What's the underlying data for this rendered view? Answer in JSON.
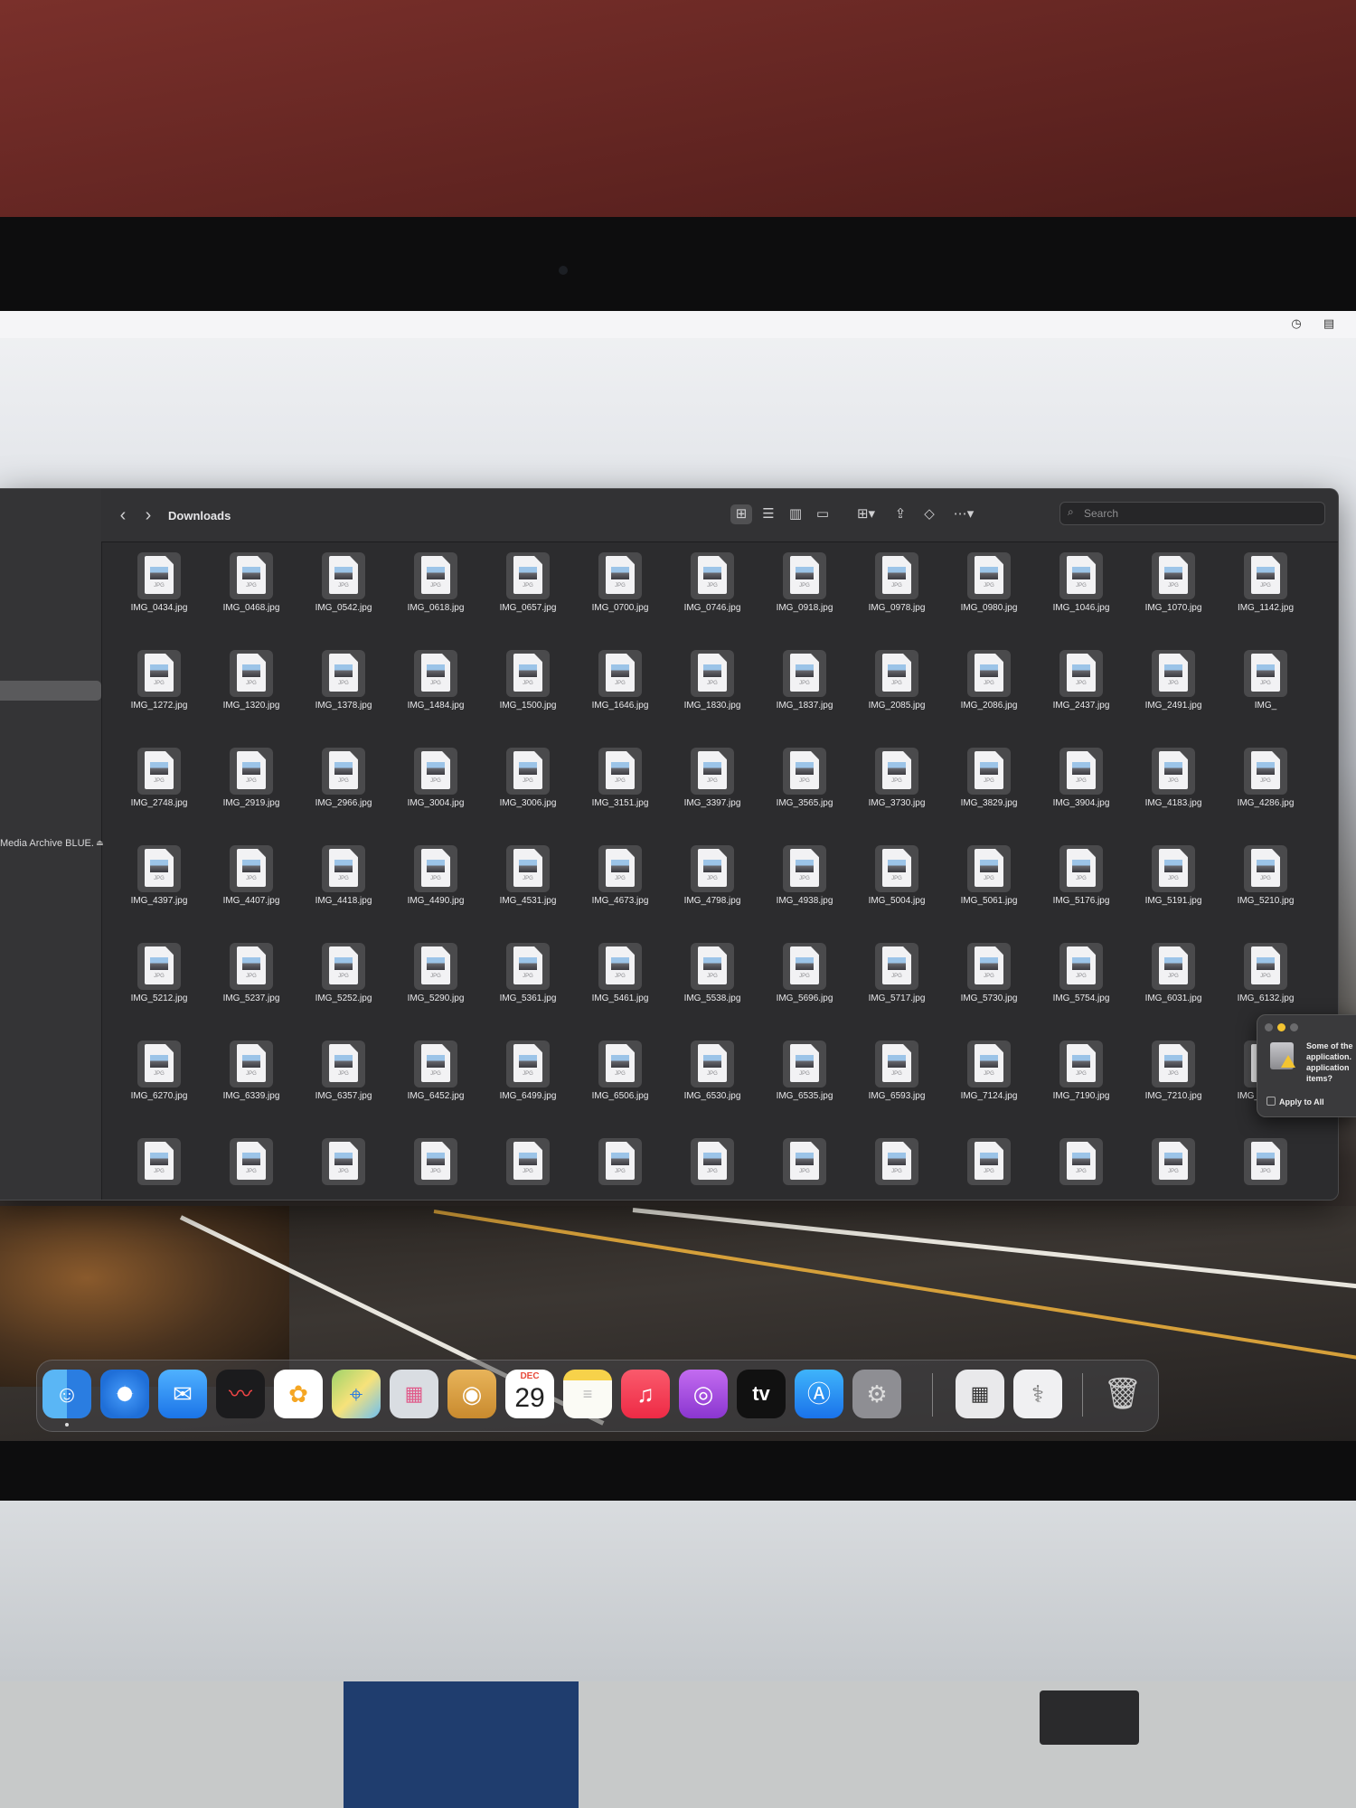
{
  "finder": {
    "title": "Downloads",
    "back": "‹",
    "forward": "›",
    "search_placeholder": "Search",
    "sidebar_volume": "Media Archive BLUE.",
    "file_ext_badge": "JPG",
    "files": [
      "IMG_0434.jpg",
      "IMG_0468.jpg",
      "IMG_0542.jpg",
      "IMG_0618.jpg",
      "IMG_0657.jpg",
      "IMG_0700.jpg",
      "IMG_0746.jpg",
      "IMG_0918.jpg",
      "IMG_0978.jpg",
      "IMG_0980.jpg",
      "IMG_1046.jpg",
      "IMG_1070.jpg",
      "IMG_1142.jpg",
      "IMG_1272.jpg",
      "IMG_1320.jpg",
      "IMG_1378.jpg",
      "IMG_1484.jpg",
      "IMG_1500.jpg",
      "IMG_1646.jpg",
      "IMG_1830.jpg",
      "IMG_1837.jpg",
      "IMG_2085.jpg",
      "IMG_2086.jpg",
      "IMG_2437.jpg",
      "IMG_2491.jpg",
      "IMG_",
      "IMG_2748.jpg",
      "IMG_2919.jpg",
      "IMG_2966.jpg",
      "IMG_3004.jpg",
      "IMG_3006.jpg",
      "IMG_3151.jpg",
      "IMG_3397.jpg",
      "IMG_3565.jpg",
      "IMG_3730.jpg",
      "IMG_3829.jpg",
      "IMG_3904.jpg",
      "IMG_4183.jpg",
      "IMG_4286.jpg",
      "IMG_4397.jpg",
      "IMG_4407.jpg",
      "IMG_4418.jpg",
      "IMG_4490.jpg",
      "IMG_4531.jpg",
      "IMG_4673.jpg",
      "IMG_4798.jpg",
      "IMG_4938.jpg",
      "IMG_5004.jpg",
      "IMG_5061.jpg",
      "IMG_5176.jpg",
      "IMG_5191.jpg",
      "IMG_5210.jpg",
      "IMG_5212.jpg",
      "IMG_5237.jpg",
      "IMG_5252.jpg",
      "IMG_5290.jpg",
      "IMG_5361.jpg",
      "IMG_5461.jpg",
      "IMG_5538.jpg",
      "IMG_5696.jpg",
      "IMG_5717.jpg",
      "IMG_5730.jpg",
      "IMG_5754.jpg",
      "IMG_6031.jpg",
      "IMG_6132.jpg",
      "IMG_6270.jpg",
      "IMG_6339.jpg",
      "IMG_6357.jpg",
      "IMG_6452.jpg",
      "IMG_6499.jpg",
      "IMG_6506.jpg",
      "IMG_6530.jpg",
      "IMG_6535.jpg",
      "IMG_6593.jpg",
      "IMG_7124.jpg",
      "IMG_7190.jpg",
      "IMG_7210.jpg",
      "IMG_7258.jpg",
      "",
      "",
      "",
      "",
      "",
      "",
      "",
      "",
      "",
      "",
      "",
      "",
      ""
    ]
  },
  "alert": {
    "message_lines": [
      "Some of the",
      "application.",
      "application",
      "items?"
    ],
    "apply_all": "Apply to All"
  },
  "dock": {
    "calendar_month": "DEC",
    "calendar_day": "29",
    "tv_label": "tv",
    "icons": [
      "finder-icon",
      "safari-icon",
      "mail-icon",
      "voice-memos-icon",
      "photos-icon",
      "maps-icon",
      "launchpad-icon",
      "contacts-icon",
      "calendar-icon",
      "notes-icon",
      "music-icon",
      "podcasts-icon",
      "apple-tv-icon",
      "app-store-icon",
      "system-preferences-icon",
      "calculator-icon",
      "disk-utility-icon",
      "trash-icon"
    ]
  },
  "colors": {
    "finder_bg": "#2c2c2e",
    "accent_yellow": "#f3c431",
    "music_red": "#f2374f",
    "podcasts_purple": "#9b4fd6"
  }
}
